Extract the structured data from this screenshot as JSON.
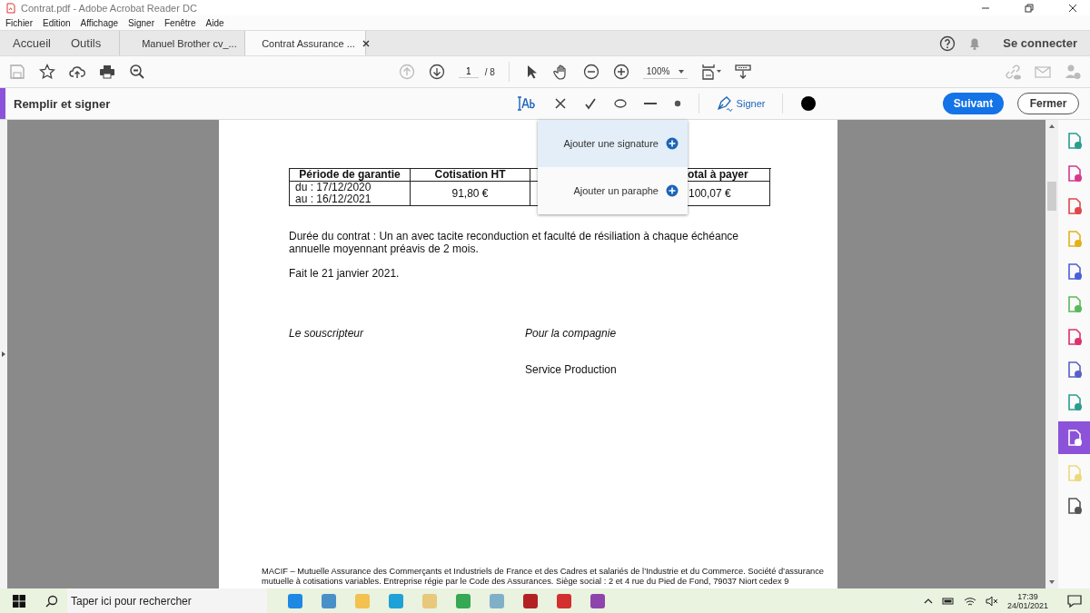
{
  "window": {
    "title": "Contrat.pdf - Adobe Acrobat Reader DC"
  },
  "menu": [
    "Fichier",
    "Edition",
    "Affichage",
    "Signer",
    "Fenêtre",
    "Aide"
  ],
  "nav_tabs": [
    "Accueil",
    "Outils"
  ],
  "doc_tabs": [
    {
      "label": "Manuel Brother cv_...",
      "selected": false
    },
    {
      "label": "Contrat Assurance ...",
      "selected": true
    }
  ],
  "sign_in": "Se connecter",
  "toolbar": {
    "page": "1",
    "pages": "/ 8",
    "zoom": "100%"
  },
  "fill_sign": {
    "title": "Remplir et signer",
    "sign_label": "Signer",
    "next": "Suivant",
    "close": "Fermer"
  },
  "sign_menu": [
    {
      "label": "Ajouter une signature",
      "selected": true
    },
    {
      "label": "Ajouter un paraphe",
      "selected": false
    }
  ],
  "document": {
    "table": {
      "columns": [
        "Période de garantie",
        "Cotisation HT",
        "otal à payer"
      ],
      "rows": [
        {
          "cells": [
            "du : 17/12/2020\nau : 16/12/2021",
            "91,80 €",
            "100,07 €"
          ]
        }
      ]
    },
    "duration": "Durée du contrat : Un an avec tacite reconduction et faculté de résiliation à chaque échéance annuelle moyennant préavis de 2 mois.",
    "date_line": "Fait le 21 janvier 2021.",
    "subscriber": "Le souscripteur",
    "company": "Pour la compagnie",
    "service": "Service Production",
    "footer": "MACIF – Mutuelle Assurance des Commerçants et Industriels de France et des Cadres et salariés de l’Industrie et du Commerce. Société d’assurance mutuelle à cotisations variables. Entreprise régie par le Code des Assurances. Siège social : 2 et 4 rue du Pied de Fond, 79037 Niort cedex 9"
  },
  "tools_panel": [
    {
      "color": "#2a9d8f",
      "selected": false
    },
    {
      "color": "#d6398c",
      "selected": false
    },
    {
      "color": "#e0474c",
      "selected": false
    },
    {
      "color": "#e2b21c",
      "selected": false
    },
    {
      "color": "#4b5fd6",
      "selected": false
    },
    {
      "color": "#5cb85c",
      "selected": false
    },
    {
      "color": "#e0306c",
      "selected": false
    },
    {
      "color": "#5a5fc8",
      "selected": false
    },
    {
      "color": "#2a9d8f",
      "selected": false
    },
    {
      "color": "#8c52d9",
      "selected": true
    },
    {
      "color": "#ecd97a",
      "selected": false
    },
    {
      "color": "#555555",
      "selected": false
    }
  ],
  "taskbar": {
    "search_placeholder": "Taper ici pour rechercher",
    "time": "17:39",
    "date": "24/01/2021"
  }
}
